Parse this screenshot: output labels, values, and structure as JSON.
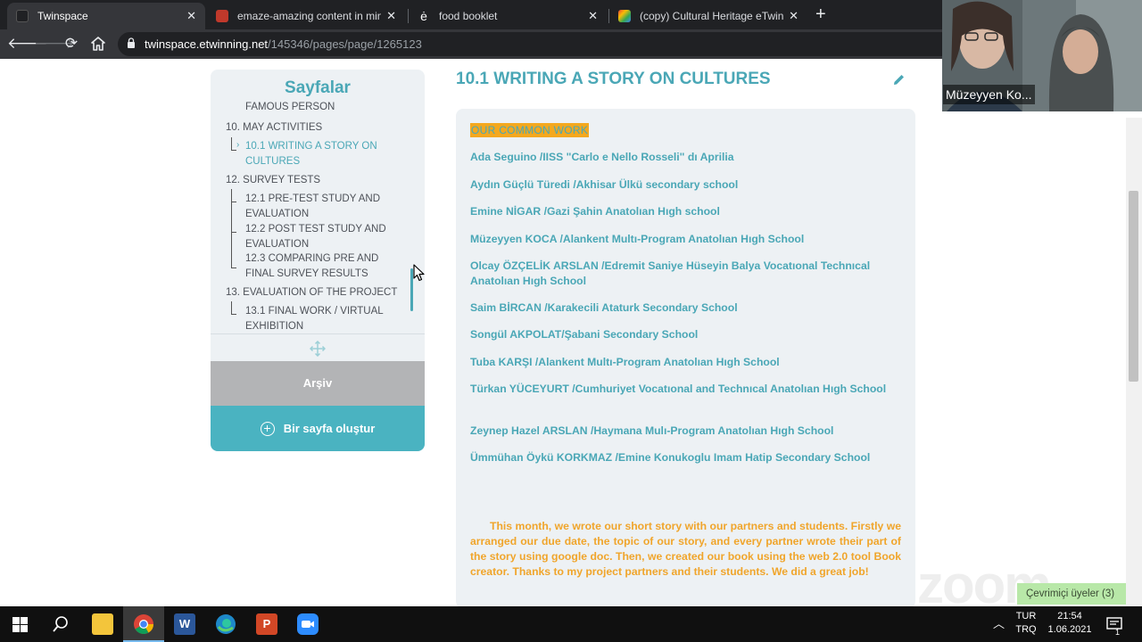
{
  "browser": {
    "tabs": [
      {
        "title": "Twinspace",
        "active": true
      },
      {
        "title": "emaze-amazing content in minut",
        "active": false
      },
      {
        "title": "food booklet",
        "active": false
      },
      {
        "title": "(copy) Cultural Heritage eTwinnin",
        "active": false
      }
    ],
    "url_host": "twinspace.etwinning.net",
    "url_path": "/145346/pages/page/1265123"
  },
  "sidebar": {
    "title": "Sayfalar",
    "items": [
      "FAMOUS PERSON",
      "10. MAY ACTIVITIES",
      "10.1 WRITING A STORY ON CULTURES",
      "12. SURVEY TESTS",
      "12.1 PRE-TEST STUDY AND EVALUATION",
      "12.2 POST TEST STUDY AND EVALUATION",
      "12.3 COMPARING PRE AND FINAL SURVEY RESULTS",
      "13. EVALUATION OF THE PROJECT",
      "13.1 FINAL WORK / VIRTUAL EXHIBITION"
    ],
    "archive_label": "Arşiv",
    "create_label": "Bir sayfa oluştur"
  },
  "main": {
    "title": "10.1 WRITING A STORY ON CULTURES",
    "highlight": "OUR COMMON WORK",
    "partners": [
      "Ada Seguino /IISS \"Carlo e Nello Rosseli\" dı Aprilia",
      "Aydın Güçlü Türedi /Akhisar Ülkü secondary school",
      "Emine NİGAR /Gazi Şahin Anatolıan Hıgh school",
      "Müzeyyen KOCA /Alankent Multı-Program Anatolıan Hıgh School",
      "Olcay ÖZÇELİK ARSLAN /Edremit Saniye Hüseyin Balya Vocatıonal Technıcal Anatolıan Hıgh School",
      "Saim BİRCAN /Karakecili Ataturk Secondary School",
      "Songül AKPOLAT/Şabani Secondary School",
      "Tuba KARŞI /Alankent Multı-Program Anatolıan Hıgh School",
      "Türkan YÜCEYURT /Cumhuriyet Vocatıonal and Technıcal Anatolıan Hıgh School",
      "Zeynep Hazel ARSLAN /Haymana Mulı-Program Anatolıan Hıgh School",
      "Ümmühan Öykü KORKMAZ /Emine Konukoglu Imam Hatip Secondary School"
    ],
    "story": "This month, we wrote our short story with our partners and students. Firstly we arranged our due date, the topic of our story, and every partner wrote their part of the story using google doc. Then, we created our book using the web 2.0 tool Book creator. Thanks to my project partners and their students. We did a great job!"
  },
  "zoom": {
    "participant_name": "Müzeyyen Ko...",
    "watermark": "zoom",
    "online_users": "Çevrimiçi üyeler (3)"
  },
  "taskbar": {
    "lang_top": "TUR",
    "lang_bottom": "TRQ",
    "time": "21:54",
    "date": "1.06.2021",
    "notification_count": "1"
  },
  "colors": {
    "accent": "#4aa7b6",
    "story": "#f0a52b",
    "highlight": "#f4a81e"
  }
}
